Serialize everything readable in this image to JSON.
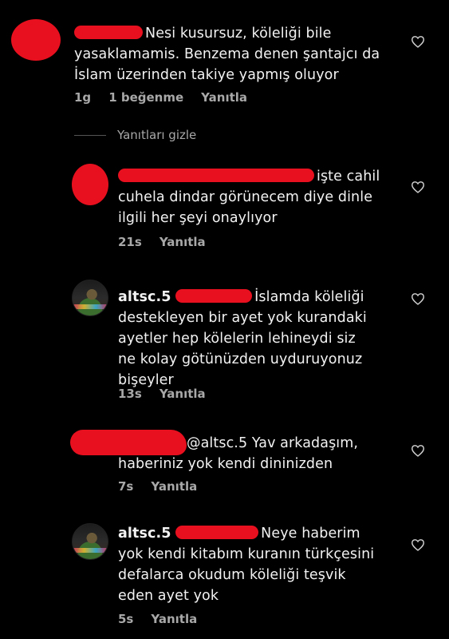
{
  "comments": [
    {
      "text_lines": [
        "Nesi kusursuz, köleliği bile",
        "yasaklamamis. Benzema denen şantajcı da",
        "İslam üzerinden takiye yapmış oluyor"
      ],
      "time": "1g",
      "likes": "1 beğenme",
      "reply": "Yanıtla"
    },
    {
      "text_lines": [
        "işte cahil",
        "cuhela dindar görünecem diye dinle",
        "ilgili her şeyi onaylıyor"
      ],
      "time": "21s",
      "reply": "Yanıtla"
    },
    {
      "username": "altsc.5",
      "text_lines": [
        "İslamda köleliği",
        "destekleyen bir ayet yok kurandaki",
        "ayetler hep kölelerin lehineydi siz",
        "ne kolay götünüzden uyduruyonuz",
        "bişeyler"
      ],
      "time": "13s",
      "reply": "Yanıtla"
    },
    {
      "mention": "@altsc.5",
      "text_lines": [
        "Yav arkadaşım,",
        "haberiniz yok kendi dininizden"
      ],
      "time": "7s",
      "reply": "Yanıtla"
    },
    {
      "username": "altsc.5",
      "text_lines": [
        "Neye haberim",
        "yok kendi kitabım kuranın türkçesini",
        "defalarca okudum köleliği teşvik",
        "eden ayet yok"
      ],
      "time": "5s",
      "reply": "Yanıtla"
    }
  ],
  "hide_replies": "Yanıtları gizle"
}
